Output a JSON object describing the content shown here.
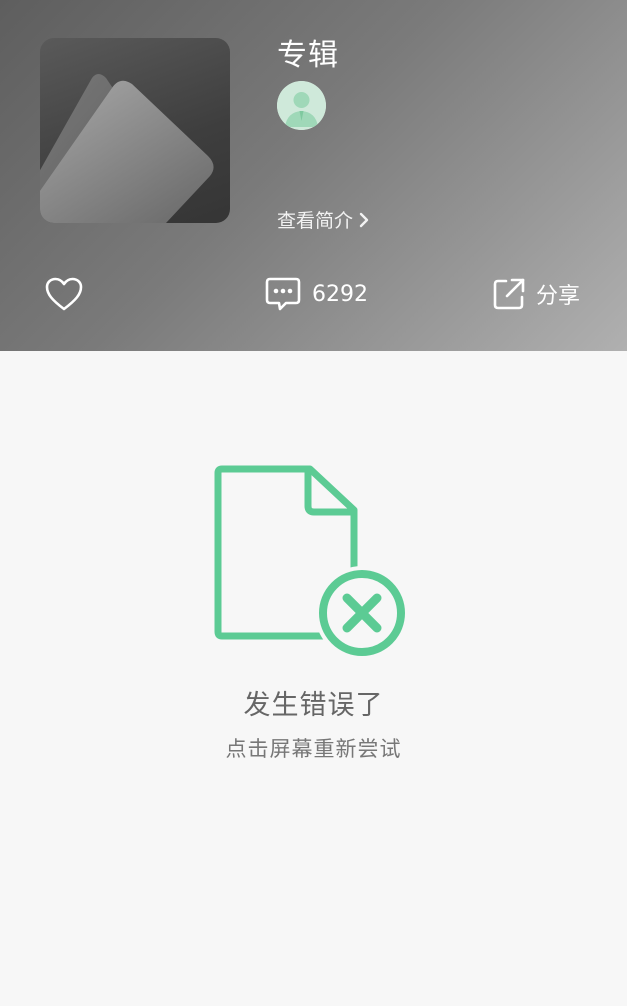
{
  "header": {
    "album_title": "专辑",
    "intro_link": "查看简介",
    "actions": {
      "like_icon": "heart-icon",
      "comment_icon": "comment-icon",
      "comment_count": "6292",
      "share_icon": "share-icon",
      "share_label": "分享"
    }
  },
  "error": {
    "icon": "document-error-icon",
    "title": "发生错误了",
    "hint": "点击屏幕重新尝试"
  },
  "colors": {
    "accent": "#5ccb94",
    "header_dark": "#5e5e5e",
    "header_light": "#b0b0b0",
    "background": "#f7f7f7"
  }
}
